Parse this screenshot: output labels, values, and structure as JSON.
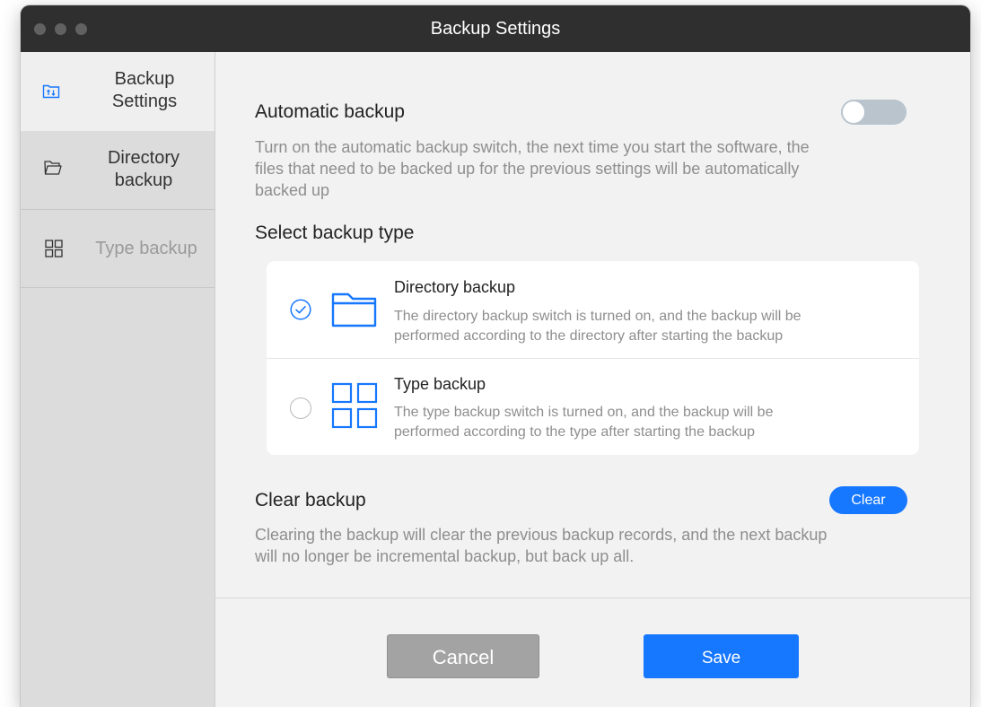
{
  "window": {
    "title": "Backup Settings"
  },
  "sidebar": {
    "items": [
      {
        "label_line1": "Backup",
        "label_line2": "Settings",
        "icon": "backup-settings-icon",
        "active": true
      },
      {
        "label_line1": "Directory",
        "label_line2": "backup",
        "icon": "folder-icon",
        "active": false
      },
      {
        "label": "Type backup",
        "icon": "grid-icon",
        "active": false
      }
    ]
  },
  "auto_backup": {
    "title": "Automatic backup",
    "enabled": false,
    "description_lines": [
      "Turn on the automatic backup switch, the next time you start the software, the",
      "files that need to be backed up for the previous settings will be automatically",
      "backed up"
    ]
  },
  "backup_type": {
    "title": "Select backup type",
    "options": [
      {
        "title": "Directory backup",
        "description_lines": [
          "The directory backup switch is turned on, and the backup will be",
          "performed according to the directory after starting the backup"
        ],
        "selected": true,
        "icon": "folder-icon"
      },
      {
        "title": "Type backup",
        "description_lines": [
          "The type backup switch is turned on, and the backup will be",
          "performed according to the type after starting the backup"
        ],
        "selected": false,
        "icon": "grid-icon"
      }
    ]
  },
  "clear_backup": {
    "title": "Clear backup",
    "button_label": "Clear",
    "description_lines": [
      "Clearing the backup will clear the previous backup records, and the next backup",
      "will no longer be incremental backup, but back up all."
    ]
  },
  "footer": {
    "cancel_label": "Cancel",
    "save_label": "Save"
  },
  "colors": {
    "accent": "#1677ff",
    "titlebar": "#2f2f2f",
    "sidebar": "#dcdcdc",
    "toggle_off": "#b9c4cd"
  }
}
